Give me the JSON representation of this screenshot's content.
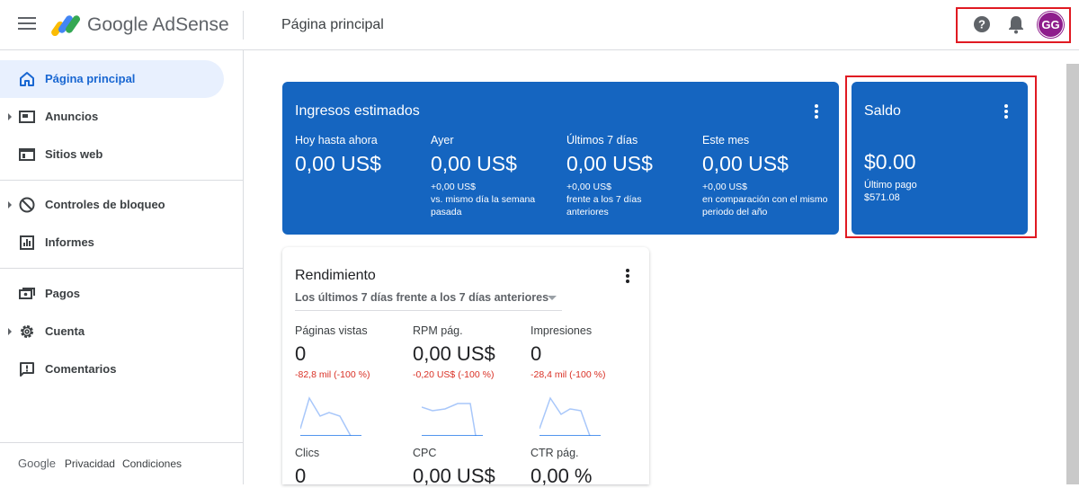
{
  "header": {
    "brand": "Google AdSense",
    "page_title": "Página principal",
    "avatar_initials": "GG",
    "avatar_color": "#8e1d8c"
  },
  "sidebar": {
    "items": [
      {
        "label": "Página principal",
        "icon": "home-icon",
        "active": true,
        "expandable": false
      },
      {
        "label": "Anuncios",
        "icon": "ads-icon",
        "active": false,
        "expandable": true
      },
      {
        "label": "Sitios web",
        "icon": "sites-icon",
        "active": false,
        "expandable": false
      },
      {
        "label": "Controles de bloqueo",
        "icon": "block-icon",
        "active": false,
        "expandable": true
      },
      {
        "label": "Informes",
        "icon": "reports-icon",
        "active": false,
        "expandable": false
      },
      {
        "label": "Pagos",
        "icon": "payments-icon",
        "active": false,
        "expandable": false
      },
      {
        "label": "Cuenta",
        "icon": "gear-icon",
        "active": false,
        "expandable": true
      },
      {
        "label": "Comentarios",
        "icon": "feedback-icon",
        "active": false,
        "expandable": false
      }
    ],
    "footer": {
      "google": "Google",
      "privacy": "Privacidad",
      "terms": "Condiciones"
    }
  },
  "ingresos": {
    "title": "Ingresos estimados",
    "columns": [
      {
        "label": "Hoy hasta ahora",
        "value": "0,00 US$",
        "change": "",
        "note": ""
      },
      {
        "label": "Ayer",
        "value": "0,00 US$",
        "change": "+0,00 US$",
        "note": "vs. mismo día la semana pasada"
      },
      {
        "label": "Últimos 7 días",
        "value": "0,00 US$",
        "change": "+0,00 US$",
        "note": "frente a los 7 días anteriores"
      },
      {
        "label": "Este mes",
        "value": "0,00 US$",
        "change": "+0,00 US$",
        "note": "en comparación con el mismo periodo del año"
      }
    ]
  },
  "saldo": {
    "title": "Saldo",
    "value": "$0.00",
    "last_payment_label": "Último pago",
    "last_payment_value": "$571.08"
  },
  "rendimiento": {
    "title": "Rendimiento",
    "range": "Los últimos 7 días frente a los 7 días anteriores",
    "metrics": [
      {
        "label": "Páginas vistas",
        "value": "0",
        "change": "-82,8 mil (-100 %)"
      },
      {
        "label": "RPM pág.",
        "value": "0,00 US$",
        "change": "-0,20 US$ (-100 %)"
      },
      {
        "label": "Impresiones",
        "value": "0",
        "change": "-28,4 mil (-100 %)"
      },
      {
        "label": "Clics",
        "value": "0",
        "change": ""
      },
      {
        "label": "CPC",
        "value": "0,00 US$",
        "change": ""
      },
      {
        "label": "CTR pág.",
        "value": "0,00 %",
        "change": ""
      }
    ]
  },
  "colors": {
    "primary_blue": "#1565c0",
    "active_nav": "#1967d2",
    "negative": "#d93025",
    "highlight_box": "#e01a22"
  }
}
